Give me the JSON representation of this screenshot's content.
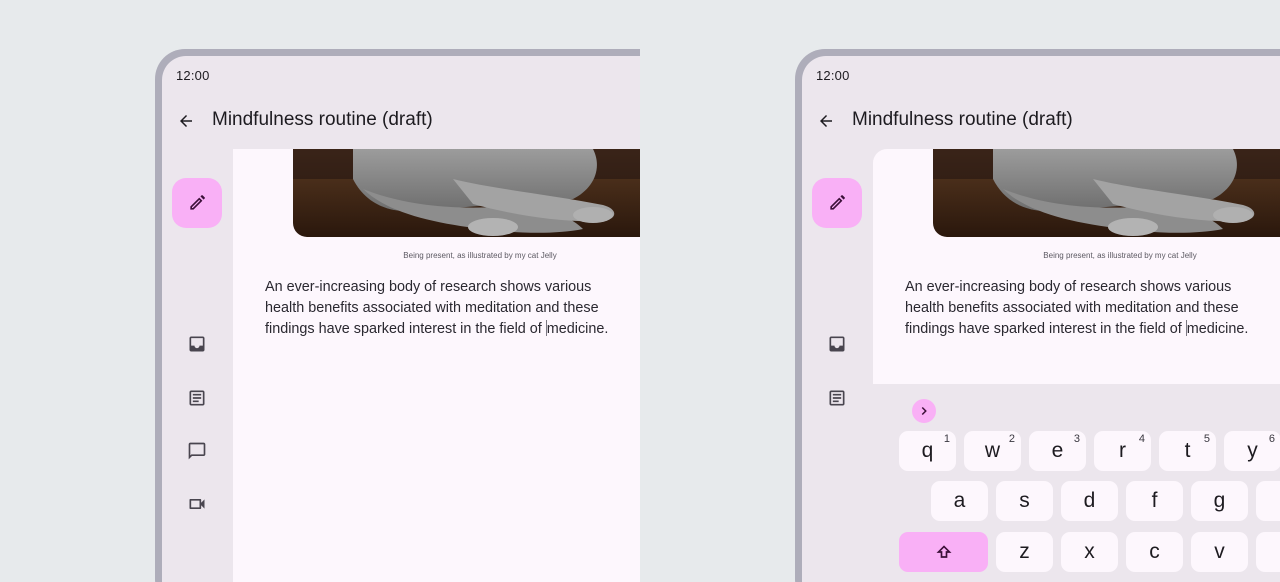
{
  "status": {
    "time": "12:00"
  },
  "header": {
    "title": "Mindfulness routine (draft)"
  },
  "rail": {
    "fab_icon": "edit-pencil-icon",
    "items": [
      "inbox-icon",
      "article-icon",
      "chat-bubble-icon",
      "videocam-icon"
    ]
  },
  "content": {
    "image_caption": "Being present, as illustrated by my cat Jelly",
    "paragraph_before_cursor": "An ever-increasing body of research shows various health benefits associated with meditation and these findings have sparked interest in the field of ",
    "paragraph_after_cursor": "medicine."
  },
  "keyboard": {
    "row1": [
      {
        "key": "q",
        "hint": "1"
      },
      {
        "key": "w",
        "hint": "2"
      },
      {
        "key": "e",
        "hint": "3"
      },
      {
        "key": "r",
        "hint": "4"
      },
      {
        "key": "t",
        "hint": "5"
      },
      {
        "key": "y",
        "hint": "6"
      }
    ],
    "row2": [
      "a",
      "s",
      "d",
      "f",
      "g"
    ],
    "row3": [
      "z",
      "x",
      "c",
      "v"
    ]
  },
  "colors": {
    "accent": "#f9b0f6",
    "surface": "#fdf7fd",
    "frame": "#aeadba"
  }
}
